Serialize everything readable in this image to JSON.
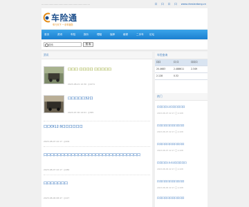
{
  "topbar": {
    "left_text": "……………………………………………………",
    "links": [
      "口",
      "口",
      "口",
      "口",
      "www.chexiantong.cn"
    ]
  },
  "logo": {
    "name": "车险通",
    "slogan": "车行天下 一手车服务"
  },
  "nav": {
    "items": [
      "首页",
      "资讯",
      "车险",
      "报价",
      "理赔",
      "保养",
      "维修",
      "二手车",
      "论坛"
    ]
  },
  "search": {
    "placeholder": "搜索",
    "button_label": "搜 索"
  },
  "main": {
    "section_title": "资讯",
    "articles": [
      {
        "title": "口口口 口口口口 口口口口口",
        "date": "2023-08-21 12:30",
        "views": "1271"
      },
      {
        "title": "口口口口口32口",
        "date": "2023-07-30 14:01",
        "views": "345"
      },
      {
        "title": "口口OI12:9口口口口口口",
        "date": "2023-08-07 22:17",
        "views": "109"
      },
      {
        "title": "口口口口口口口口口口口口口口口口口口口口口口口口口口口口",
        "date": "2023-08-07 22:17",
        "views": "180"
      },
      {
        "title": "口口口口口口口",
        "date": "2023-08-06 08:47",
        "views": "127"
      }
    ]
  },
  "side": {
    "table_title": "车险查询",
    "table": {
      "headers": [
        "口口",
        "口 口",
        "口口口"
      ],
      "rows": [
        [
          "20.4683",
          "2.488611",
          "2.349"
        ],
        [
          "2.128",
          "0.32",
          ""
        ]
      ]
    },
    "section_title": "热门",
    "items": [
      {
        "title": "口口口口12口口口口口口",
        "meta": "2023-08-07 22:17  口 2,228"
      },
      {
        "title": "口口口口口口口口口口口",
        "meta": "2023-08-07 22:17  口 2,228"
      },
      {
        "title": "口口口口口口口口口口口",
        "meta": "2023-08-07 22:17  口 2,228"
      },
      {
        "title": "口口口口13:32口口口口口",
        "meta": "2023-08-05 22:17  口 2,228"
      },
      {
        "title": "口口口口口口口口口口口",
        "meta": "2023-08-05 22:17  口 2,228"
      },
      {
        "title": "口口口口口口口口口口口",
        "meta": "2023-08-05 22:17  口 2,228"
      }
    ]
  },
  "colors": {
    "nav": "#1b7fd0",
    "link": "#1a62b5",
    "accent_title": "#8a9c14"
  }
}
